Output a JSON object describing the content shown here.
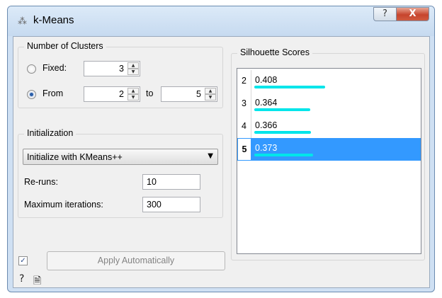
{
  "window": {
    "title": "k-Means",
    "help_glyph": "?",
    "close_glyph": "X"
  },
  "clusters": {
    "legend": "Number of Clusters",
    "fixed_label": "Fixed:",
    "fixed_value": "3",
    "from_label": "From",
    "from_value": "2",
    "to_label": "to",
    "to_value": "5",
    "selected_mode": "from"
  },
  "initialization": {
    "legend": "Initialization",
    "method": "Initialize with KMeans++",
    "reruns_label": "Re-runs:",
    "reruns_value": "10",
    "max_iter_label": "Maximum iterations:",
    "max_iter_value": "300"
  },
  "silhouette": {
    "legend": "Silhouette Scores",
    "rows": [
      {
        "k": "2",
        "score": "0.408",
        "bar": 0.408,
        "selected": false
      },
      {
        "k": "3",
        "score": "0.364",
        "bar": 0.364,
        "selected": false
      },
      {
        "k": "4",
        "score": "0.366",
        "bar": 0.366,
        "selected": false
      },
      {
        "k": "5",
        "score": "0.373",
        "bar": 0.373,
        "selected": true
      }
    ],
    "bar_color": "#00e5ea",
    "selection_color": "#3399ff"
  },
  "footer": {
    "auto_apply_checked": true,
    "apply_label": "Apply Automatically",
    "help_icon": "help-icon",
    "report_icon": "report-icon"
  }
}
